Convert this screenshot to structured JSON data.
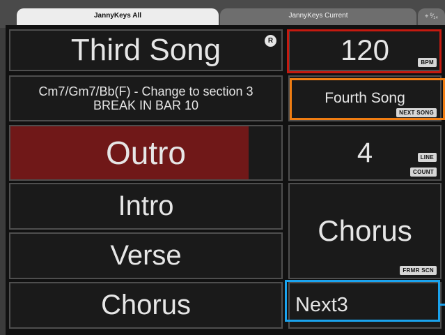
{
  "tabs": {
    "active": "JannyKeys All",
    "inactive": "JannyKeys Current",
    "extra": "⌖ ⁰⁄₁₄"
  },
  "song": {
    "title": "Third Song",
    "badge": "R",
    "notes_line1": "Cm7/Gm7/Bb(F) - Change to section 3",
    "notes_line2": "BREAK IN BAR 10"
  },
  "bpm": {
    "value": "120",
    "tag": "BPM"
  },
  "next_song": {
    "value": "Fourth Song",
    "tag": "NEXT SONG"
  },
  "line_count": {
    "value": "4",
    "tag1": "LINE",
    "tag2": "COUNT"
  },
  "sections": [
    {
      "label": "Outro",
      "progress": 0.88
    },
    {
      "label": "Intro"
    },
    {
      "label": "Verse"
    },
    {
      "label": "Chorus"
    }
  ],
  "former_section": {
    "value": "Chorus",
    "tag": "FRMR SCN"
  },
  "next_section": {
    "value": "Next3"
  },
  "colors": {
    "active_fill": "#701818",
    "bpm_outline": "#c41a10",
    "next_song_outline": "#f07d12",
    "next_outline": "#1aa3ee"
  }
}
